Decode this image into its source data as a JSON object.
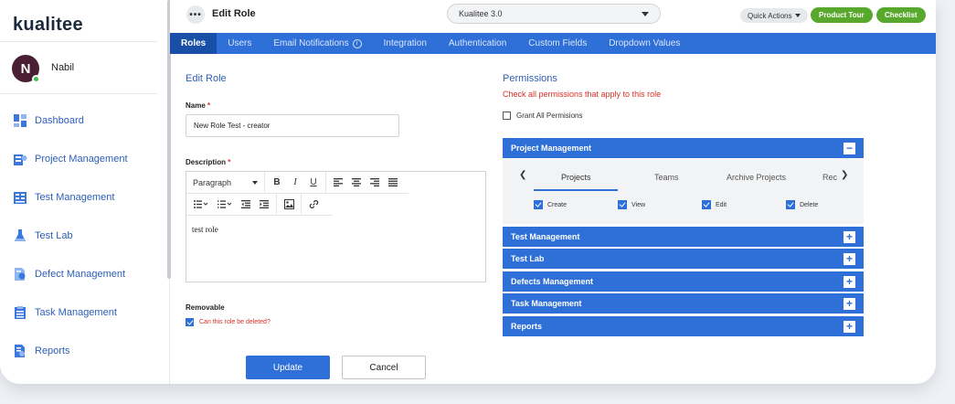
{
  "brand": {
    "logo_text": "kualitee"
  },
  "user": {
    "initial": "N",
    "name": "Nabil"
  },
  "sidebar": {
    "items": [
      {
        "label": "Dashboard",
        "icon": "dashboard-icon"
      },
      {
        "label": "Project Management",
        "icon": "project-icon"
      },
      {
        "label": "Test Management",
        "icon": "test-management-icon"
      },
      {
        "label": "Test Lab",
        "icon": "flask-icon"
      },
      {
        "label": "Defect Management",
        "icon": "defect-icon"
      },
      {
        "label": "Task Management",
        "icon": "task-icon"
      },
      {
        "label": "Reports",
        "icon": "reports-icon"
      }
    ]
  },
  "topbar": {
    "title": "Edit Role",
    "project": "Kualitee 3.0",
    "quick_actions": "Quick Actions",
    "product_tour": "Product Tour",
    "checklist": "Checklist"
  },
  "tabs": [
    "Roles",
    "Users",
    "Email Notifications",
    "Integration",
    "Authentication",
    "Custom Fields",
    "Dropdown Values"
  ],
  "form": {
    "section_title": "Edit Role",
    "name_label": "Name",
    "name_value": "New Role Test - creator",
    "description_label": "Description",
    "editor_format": "Paragraph",
    "description_value": "test role",
    "removable_label": "Removable",
    "removable_checkbox_label": "Can this role be deleted?",
    "update_label": "Update",
    "cancel_label": "Cancel"
  },
  "permissions": {
    "title": "Permissions",
    "subtitle": "Check all permissions that apply to this role",
    "grant_all": "Grant All Permisions",
    "sections": [
      {
        "label": "Project Management",
        "expanded": true
      },
      {
        "label": "Test Management",
        "expanded": false
      },
      {
        "label": "Test Lab",
        "expanded": false
      },
      {
        "label": "Defects Management",
        "expanded": false
      },
      {
        "label": "Task Management",
        "expanded": false
      },
      {
        "label": "Reports",
        "expanded": false
      }
    ],
    "sub_tabs": [
      "Projects",
      "Teams",
      "Archive Projects",
      "Rec"
    ],
    "actions": [
      "Create",
      "View",
      "Edit",
      "Delete"
    ]
  },
  "colors": {
    "primary": "#2e6fd8",
    "green": "#58a82d",
    "required": "#d93025"
  }
}
